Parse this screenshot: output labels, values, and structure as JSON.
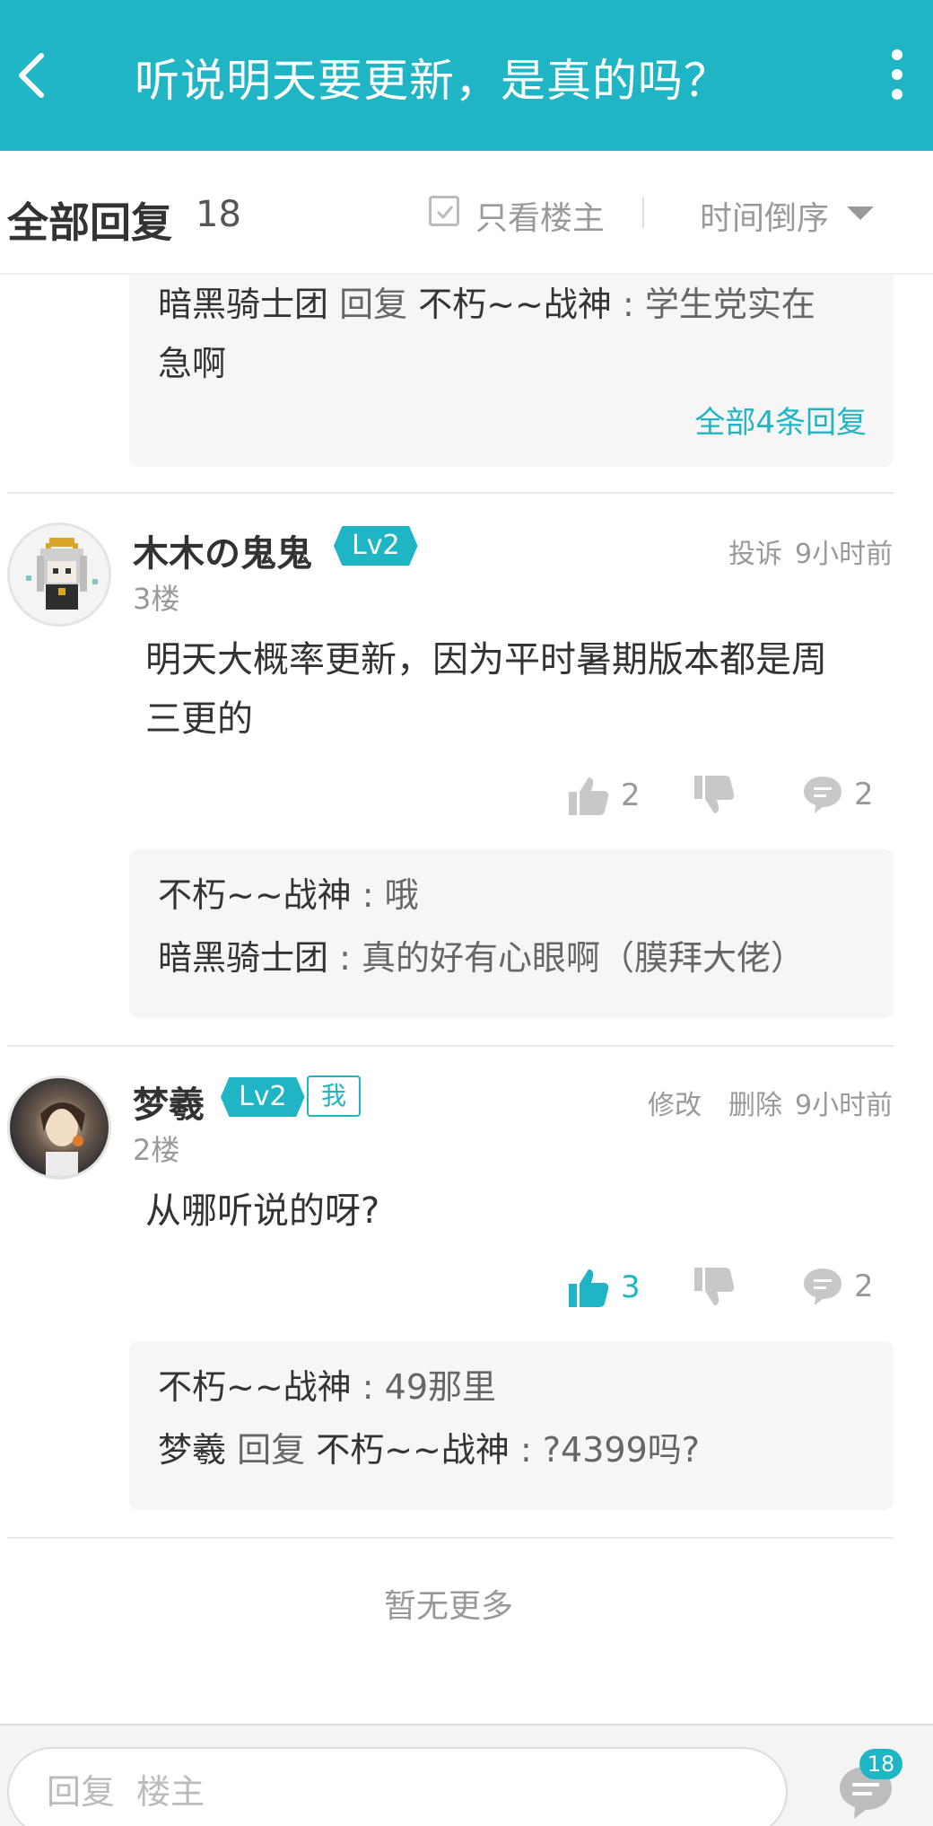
{
  "header": {
    "title": "听说明天要更新，是真的吗？"
  },
  "filterbar": {
    "title": "全部回复",
    "count": "18",
    "only_op_label": "只看楼主",
    "sort_label": "时间倒序"
  },
  "top_replies": {
    "lines": [
      {
        "author": "暗黑骑士团",
        "reply_word": "回复",
        "target": "不朽~~战神",
        "text": " : 学生党实在"
      },
      {
        "text": "急啊"
      }
    ],
    "more_link": "全部4条回复"
  },
  "comments": [
    {
      "username": "木木の鬼鬼",
      "level": "Lv2",
      "floor": "3楼",
      "report": "投诉",
      "time": "9小时前",
      "content_line1": "明天大概率更新，因为平时暑期版本都是周",
      "content_line2": "三更的",
      "likes": "2",
      "comments": "2",
      "replies": [
        {
          "author": "不朽~~战神",
          "text": " : 哦"
        },
        {
          "author": "暗黑骑士团",
          "text": " : 真的好有心眼啊（膜拜大佬）"
        }
      ]
    },
    {
      "username": "梦羲",
      "level": "Lv2",
      "me_badge": "我",
      "floor": "2楼",
      "edit": "修改",
      "delete": "删除",
      "time": "9小时前",
      "content": "从哪听说的呀?",
      "likes": "3",
      "comments": "2",
      "replies": [
        {
          "author": "不朽~~战神",
          "text": " : 49那里"
        },
        {
          "author": "梦羲",
          "reply_word": "回复",
          "target": "不朽~~战神",
          "text": " : ?4399吗?"
        }
      ]
    }
  ],
  "no_more": "暂无更多",
  "bottombar": {
    "placeholder": "回复  楼主",
    "comment_count": "18"
  },
  "colors": {
    "accent": "#1fb5c4",
    "muted": "#999999",
    "reply_bg": "#f6f6f6"
  },
  "icons": {
    "back": "back-arrow-icon",
    "more": "more-vertical-icon",
    "like": "thumbs-up-icon",
    "dislike": "thumbs-down-icon",
    "comment": "comment-bubble-icon",
    "comments_list": "comments-list-icon"
  }
}
